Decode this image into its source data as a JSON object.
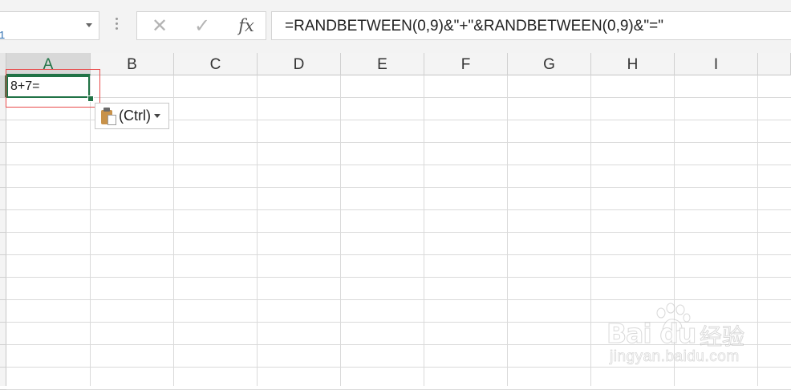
{
  "name_box": {
    "value": "1"
  },
  "formula_bar": {
    "cancel_icon": "✕",
    "enter_icon": "✓",
    "fx_label": "fx",
    "formula": "=RANDBETWEEN(0,9)&\"+\"&RANDBETWEEN(0,9)&\"=\""
  },
  "columns": [
    "A",
    "B",
    "C",
    "D",
    "E",
    "F",
    "G",
    "H",
    "I"
  ],
  "active_column": "A",
  "active_row": 1,
  "cells": {
    "A1": "8+7="
  },
  "paste_options": {
    "label": "(Ctrl)",
    "icon": "clipboard-paste-icon"
  },
  "watermark": {
    "brand": "Bai du",
    "brand_cn": "经验",
    "url": "jingyan.baidu.com"
  },
  "colors": {
    "selection": "#217346",
    "highlight": "#e94a4a"
  }
}
